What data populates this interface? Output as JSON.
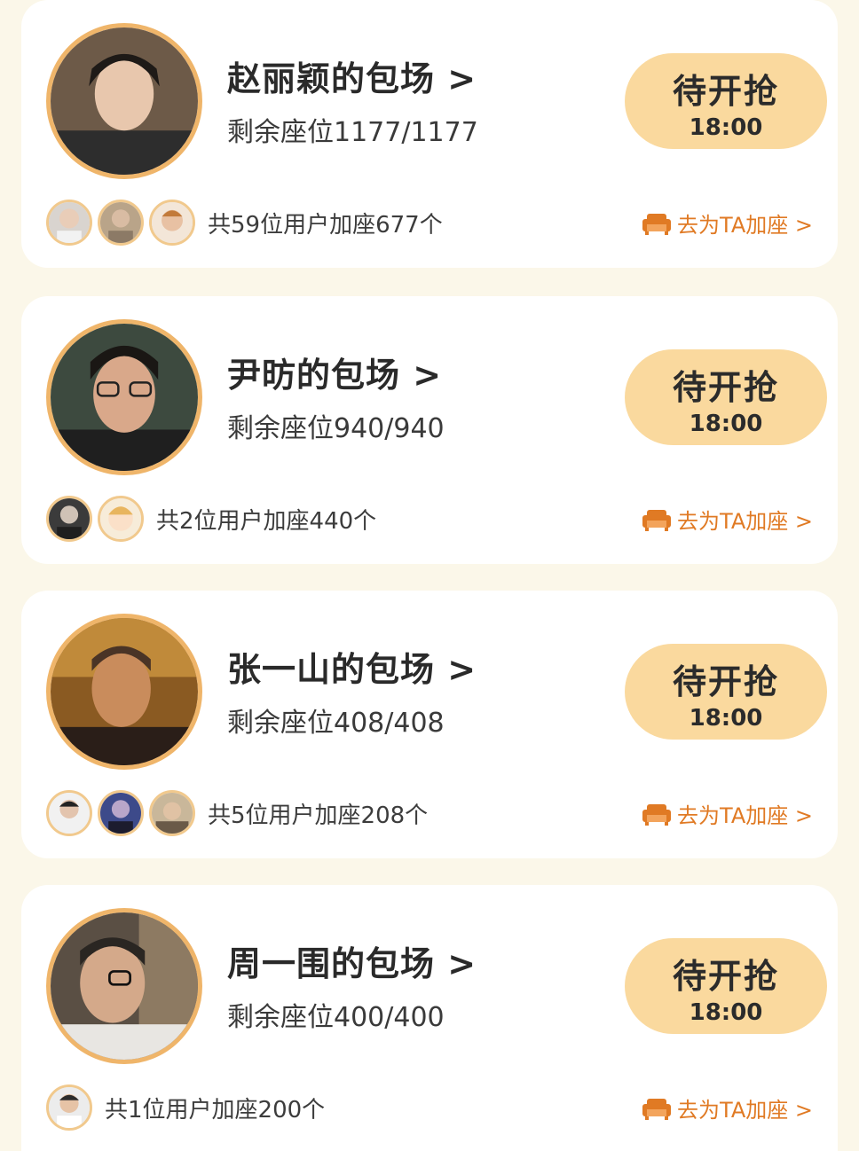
{
  "theme": {
    "accent": "#e07a24",
    "button_bg": "#fad99e",
    "ring": "#efb56a",
    "page_bg": "#fbf7e9"
  },
  "cards": [
    {
      "title": "赵丽颖的包场 >",
      "seats": "剩余座位1177/1177",
      "button_label": "待开抢",
      "button_time": "18:00",
      "supporters_text": "共59位用户加座677个",
      "add_seat": "去为TA加座 >",
      "avatar_count": 3
    },
    {
      "title": "尹昉的包场 >",
      "seats": "剩余座位940/940",
      "button_label": "待开抢",
      "button_time": "18:00",
      "supporters_text": "共2位用户加座440个",
      "add_seat": "去为TA加座 >",
      "avatar_count": 2
    },
    {
      "title": "张一山的包场 >",
      "seats": "剩余座位408/408",
      "button_label": "待开抢",
      "button_time": "18:00",
      "supporters_text": "共5位用户加座208个",
      "add_seat": "去为TA加座 >",
      "avatar_count": 3
    },
    {
      "title": "周一围的包场 >",
      "seats": "剩余座位400/400",
      "button_label": "待开抢",
      "button_time": "18:00",
      "supporters_text": "共1位用户加座200个",
      "add_seat": "去为TA加座 >",
      "avatar_count": 1
    }
  ]
}
